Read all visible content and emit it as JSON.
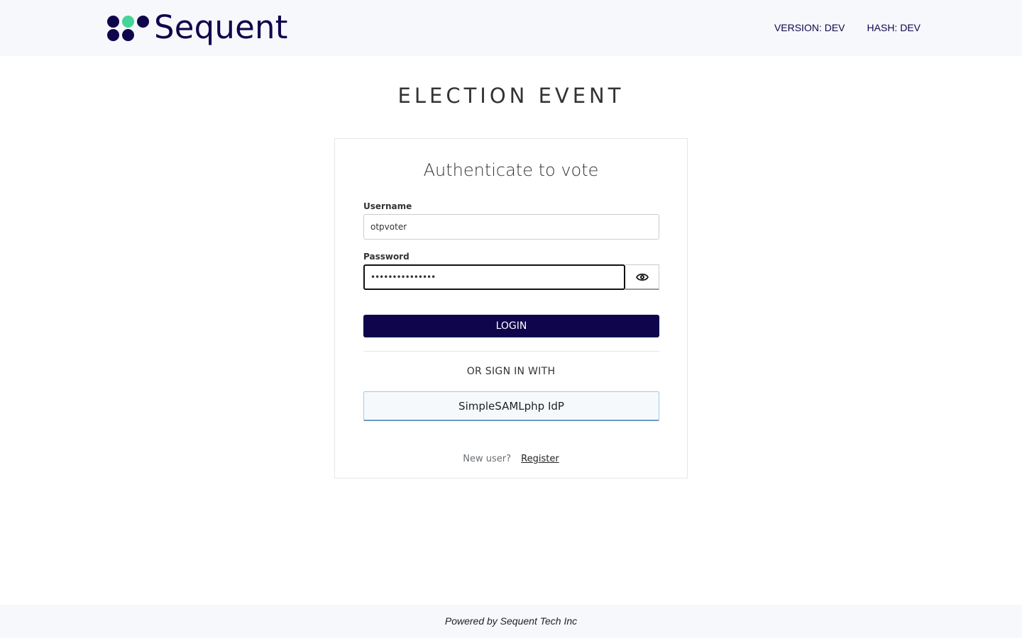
{
  "header": {
    "brand": "Sequent",
    "version_label": "VERSION: DEV",
    "hash_label": "HASH: DEV",
    "brand_color": "#0f054c",
    "accent_color": "#43d59a"
  },
  "page": {
    "title": "ELECTION EVENT"
  },
  "login_card": {
    "title": "Authenticate to vote",
    "username_label": "Username",
    "username_value": "otpvoter",
    "password_label": "Password",
    "password_value": "•••••••••••••••",
    "show_password_icon": "eye-icon",
    "login_button": "LOGIN",
    "or_sign_in_with": "OR SIGN IN WITH",
    "idp_button": "SimpleSAMLphp IdP",
    "new_user_text": "New user?",
    "register_link": "Register"
  },
  "footer": {
    "text": "Powered by Sequent Tech Inc"
  }
}
